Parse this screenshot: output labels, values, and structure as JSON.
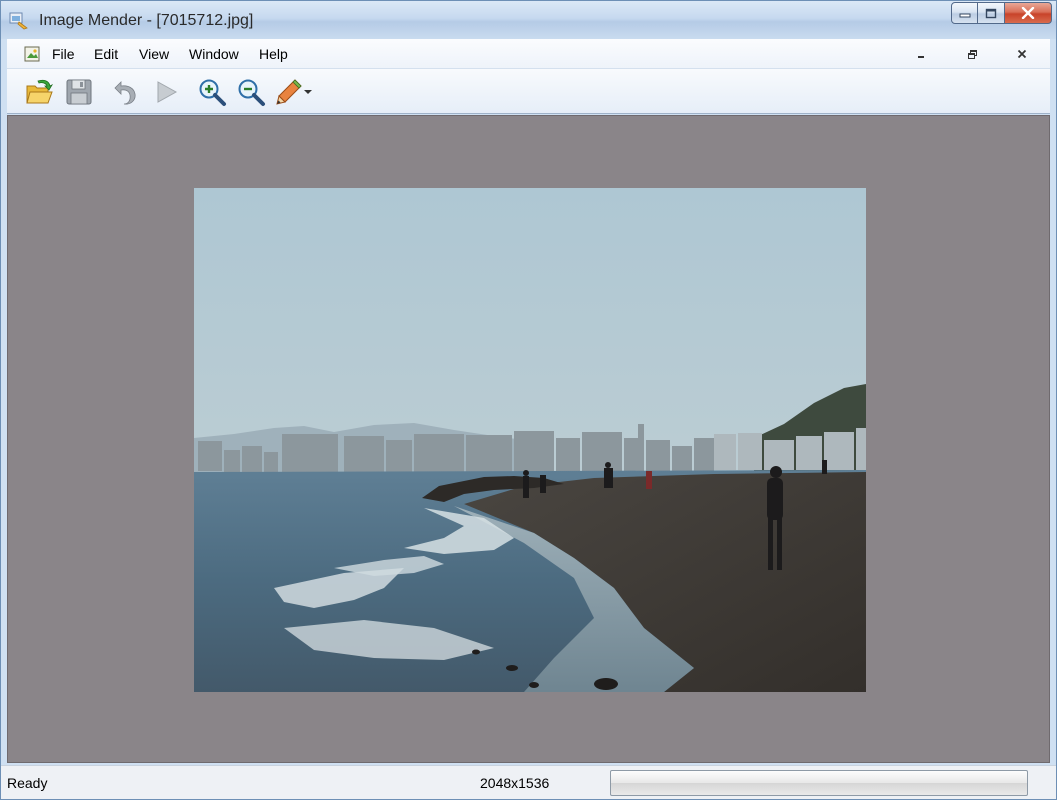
{
  "window": {
    "title": "Image Mender - [7015712.jpg]"
  },
  "menu": {
    "items": [
      "File",
      "Edit",
      "View",
      "Window",
      "Help"
    ]
  },
  "toolbar": {
    "buttons": [
      "open-folder-icon",
      "save-disk-icon",
      "undo-arrow-icon",
      "play-triangle-icon",
      "zoom-in-icon",
      "zoom-out-icon",
      "pencil-icon",
      "dropdown-arrow-icon"
    ]
  },
  "status": {
    "text": "Ready",
    "dimensions": "2048x1536",
    "progress": 0
  },
  "colors": {
    "workspace": "#8a8589",
    "titlebar": "#c6d9ef",
    "close_button": "#c8432a"
  }
}
